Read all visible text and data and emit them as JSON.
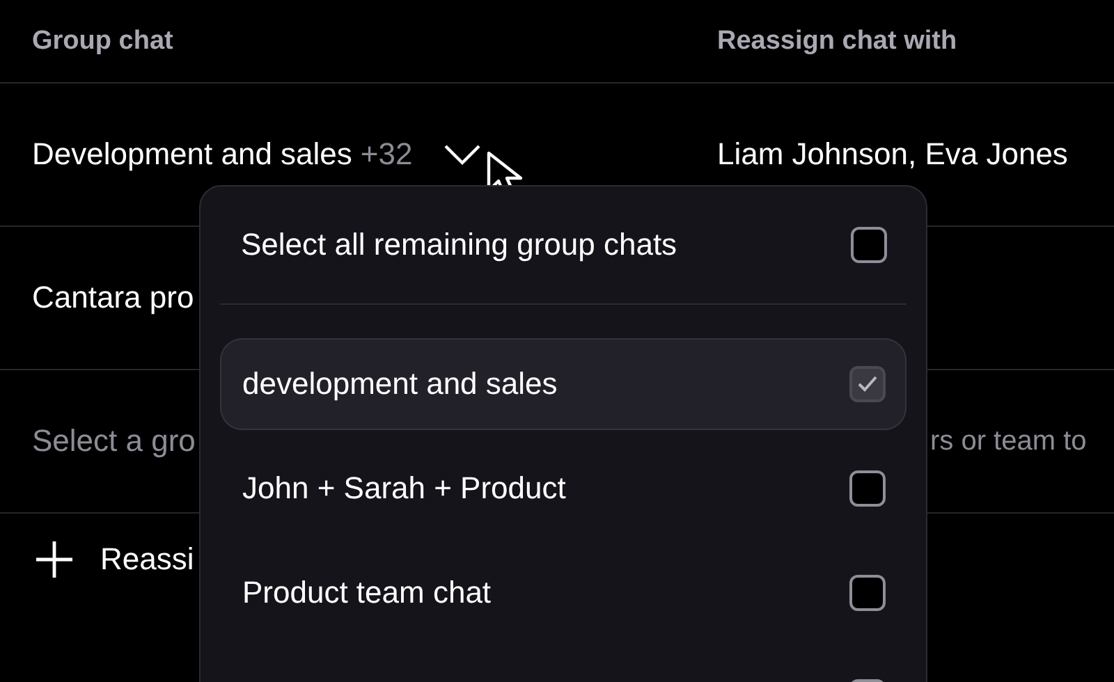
{
  "table": {
    "columns": [
      "Group chat",
      "Reassign chat with"
    ],
    "rows": [
      {
        "kind": "chat",
        "group": "Development and sales",
        "count": "+32",
        "expanded": true,
        "assignees": "Liam Johnson, Eva Jones"
      },
      {
        "kind": "chat",
        "group": "Cantara pro",
        "assignees": ""
      },
      {
        "kind": "placeholder",
        "group": "Select a gro",
        "assignees": "rs or team to"
      }
    ]
  },
  "add_button": {
    "label": "Reassi"
  },
  "dropdown": {
    "select_all": {
      "label": "Select all remaining group chats",
      "checked": false
    },
    "items": [
      {
        "label": "development and sales",
        "checked": true,
        "selected": true
      },
      {
        "label": "John + Sarah + Product",
        "checked": false,
        "selected": false
      },
      {
        "label": "Product team chat",
        "checked": false,
        "selected": false
      },
      {
        "checked": false,
        "selected": false
      }
    ]
  }
}
